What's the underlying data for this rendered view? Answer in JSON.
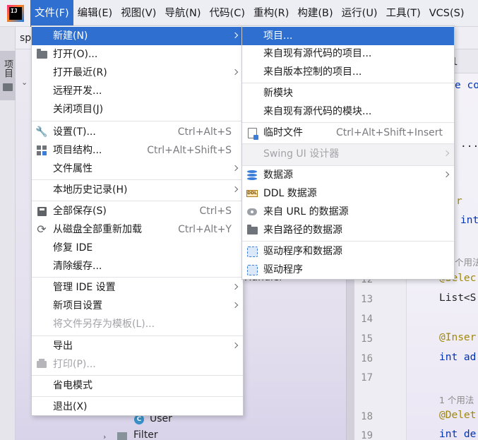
{
  "app_logo_text": "IJ",
  "menubar": {
    "items": [
      "文件(F)",
      "编辑(E)",
      "视图(V)",
      "导航(N)",
      "代码(C)",
      "重构(R)",
      "构建(B)",
      "运行(U)",
      "工具(T)",
      "VCS(S)"
    ],
    "active_index": 0
  },
  "background": {
    "breadcrumb_text": "sp",
    "project_tool_label": "项目",
    "tree_handler_label": "Handler",
    "tree_user_icon_letter": "C",
    "tree_user_label": "User",
    "tree_filter_label": "Filter",
    "editor_tab_frag": "l",
    "code_frag_1": "e co",
    "code_frag_2": "...",
    "code_frag_3": "r",
    "code_frag_4": "int",
    "hint_1": "个用法",
    "annot_select": "@Selec",
    "code_list": "List<S",
    "annot_insert": "@Inser",
    "code_int_add": "int ad",
    "hint_2": "1 个用法",
    "annot_delete": "@Delet",
    "code_int_del": "int de",
    "line_numbers": [
      "12",
      "13",
      "14",
      "15",
      "16",
      "17",
      "18",
      "19"
    ]
  },
  "file_menu": {
    "items": [
      {
        "label": "新建(N)",
        "shortcut": "",
        "submenu": true,
        "icon": "",
        "highlighted": true
      },
      {
        "label": "打开(O)...",
        "shortcut": "",
        "submenu": false,
        "icon": "folder-icon"
      },
      {
        "label": "打开最近(R)",
        "shortcut": "",
        "submenu": true,
        "icon": ""
      },
      {
        "label": "远程开发...",
        "shortcut": "",
        "submenu": false,
        "icon": ""
      },
      {
        "label": "关闭项目(J)",
        "shortcut": "",
        "submenu": false,
        "icon": ""
      },
      {
        "label": "设置(T)...",
        "shortcut": "Ctrl+Alt+S",
        "submenu": false,
        "icon": "wrench-icon"
      },
      {
        "label": "项目结构...",
        "shortcut": "Ctrl+Alt+Shift+S",
        "submenu": false,
        "icon": "project-structure-icon"
      },
      {
        "label": "文件属性",
        "shortcut": "",
        "submenu": true,
        "icon": ""
      },
      {
        "label": "本地历史记录(H)",
        "shortcut": "",
        "submenu": true,
        "icon": ""
      },
      {
        "label": "全部保存(S)",
        "shortcut": "Ctrl+S",
        "submenu": false,
        "icon": "save-icon"
      },
      {
        "label": "从磁盘全部重新加载",
        "shortcut": "Ctrl+Alt+Y",
        "submenu": false,
        "icon": "reload-icon"
      },
      {
        "label": "修复 IDE",
        "shortcut": "",
        "submenu": false,
        "icon": ""
      },
      {
        "label": "清除缓存...",
        "shortcut": "",
        "submenu": false,
        "icon": ""
      },
      {
        "label": "管理 IDE 设置",
        "shortcut": "",
        "submenu": true,
        "icon": ""
      },
      {
        "label": "新项目设置",
        "shortcut": "",
        "submenu": true,
        "icon": ""
      },
      {
        "label": "将文件另存为模板(L)...",
        "shortcut": "",
        "submenu": false,
        "icon": "",
        "disabled": true
      },
      {
        "label": "导出",
        "shortcut": "",
        "submenu": true,
        "icon": ""
      },
      {
        "label": "打印(P)...",
        "shortcut": "",
        "submenu": false,
        "icon": "print-icon",
        "disabled": true
      },
      {
        "label": "省电模式",
        "shortcut": "",
        "submenu": false,
        "icon": ""
      },
      {
        "label": "退出(X)",
        "shortcut": "",
        "submenu": false,
        "icon": ""
      }
    ]
  },
  "new_submenu": {
    "items": [
      {
        "label": "项目...",
        "shortcut": "",
        "submenu": false,
        "icon": "",
        "highlighted": true
      },
      {
        "label": "来自现有源代码的项目...",
        "shortcut": "",
        "submenu": false,
        "icon": ""
      },
      {
        "label": "来自版本控制的项目...",
        "shortcut": "",
        "submenu": false,
        "icon": ""
      },
      {
        "label": "新模块",
        "shortcut": "",
        "submenu": false,
        "icon": ""
      },
      {
        "label": "来自现有源代码的模块...",
        "shortcut": "",
        "submenu": false,
        "icon": ""
      },
      {
        "label": "临时文件",
        "shortcut": "Ctrl+Alt+Shift+Insert",
        "submenu": false,
        "icon": "scratch-file-icon"
      },
      {
        "label": "Swing UI 设计器",
        "shortcut": "",
        "submenu": true,
        "icon": "",
        "disabled": true
      },
      {
        "label": "数据源",
        "shortcut": "",
        "submenu": true,
        "icon": "database-icon"
      },
      {
        "label": "DDL 数据源",
        "shortcut": "",
        "submenu": false,
        "icon": "ddl-icon",
        "icon_text": "DDL"
      },
      {
        "label": "来自 URL 的数据源",
        "shortcut": "",
        "submenu": false,
        "icon": "url-icon"
      },
      {
        "label": "来自路径的数据源",
        "shortcut": "",
        "submenu": false,
        "icon": "folder-icon"
      },
      {
        "label": "驱动程序和数据源",
        "shortcut": "",
        "submenu": false,
        "icon": "driver-icon"
      },
      {
        "label": "驱动程序",
        "shortcut": "",
        "submenu": false,
        "icon": "driver-icon"
      }
    ]
  }
}
